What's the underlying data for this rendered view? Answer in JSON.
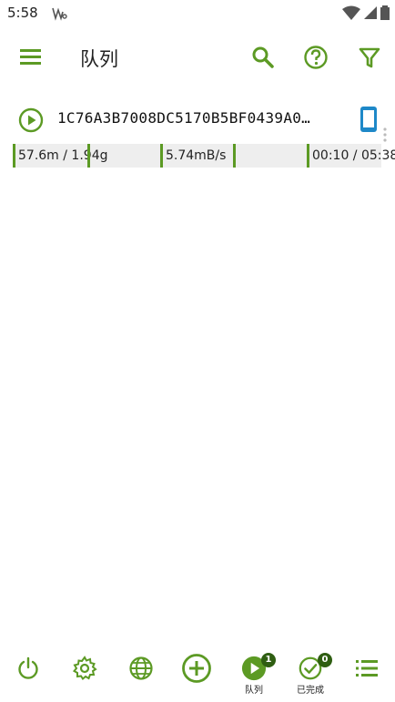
{
  "status_bar": {
    "time": "5:58"
  },
  "app_bar": {
    "title": "队列"
  },
  "queue": {
    "items": [
      {
        "name": "1C76A3B7008DC5170B5BF0439A0…",
        "progress": "57.6m / 1.94g",
        "progress_fraction": 0.029,
        "speed": "5.74mB/s",
        "time": "00:10 / 05:38"
      }
    ]
  },
  "bottom_nav": {
    "queue_label": "队列",
    "queue_count": "1",
    "completed_label": "已完成",
    "completed_count": "0"
  },
  "colors": {
    "accent": "#5c9a24",
    "badge": "#2f5e12",
    "device": "#1e88c8"
  }
}
